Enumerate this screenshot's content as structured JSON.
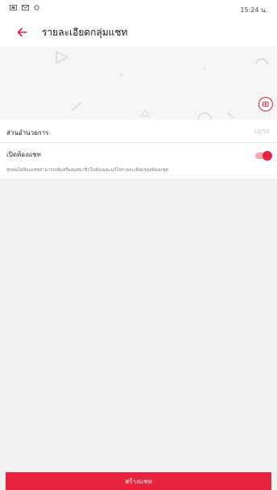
{
  "status_bar": {
    "time": "15:24 น.",
    "icons": [
      "notification-icon",
      "mail-icon",
      "sync-icon"
    ]
  },
  "header": {
    "back_icon": "arrow-left-icon",
    "title": "รายละเอียดกลุ่มแชท"
  },
  "cover": {
    "edit_icon": "camera-edit-icon"
  },
  "settings": {
    "ownership": {
      "label": "ส่วนอำนวยการ",
      "value": "12/50"
    },
    "open_chat": {
      "label": "เปิดห้องแชท",
      "enabled": true,
      "description": "ทุกคนได้ห้องแชทสามารถเพิ่มหรือลบสมาชิกในห้องและแก้ไขรายละเอียดของห้องแชท"
    }
  },
  "footer": {
    "create_label": "สร้างแชท"
  },
  "colors": {
    "accent": "#e8233e",
    "toggle_track": "#f3a7b1",
    "background": "#f2f2f2"
  }
}
